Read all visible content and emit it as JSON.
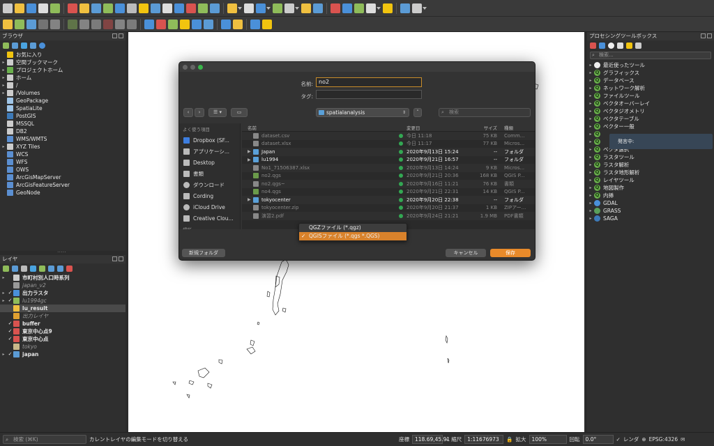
{
  "browser": {
    "title": "ブラウザ",
    "items": [
      {
        "label": "お気に入り",
        "icon": "star-icon",
        "color": "#f1c40f"
      },
      {
        "label": "空間ブックマーク",
        "icon": "bookmark-icon",
        "color": "#cccccc"
      },
      {
        "label": "プロジェクトホーム",
        "icon": "project-home-icon",
        "color": "#6ab04c"
      },
      {
        "label": "ホーム",
        "icon": "home-icon",
        "color": "#cccccc"
      },
      {
        "label": "/",
        "icon": "folder-icon",
        "color": "#cccccc"
      },
      {
        "label": "/Volumes",
        "icon": "folder-icon",
        "color": "#cccccc"
      },
      {
        "label": "GeoPackage",
        "icon": "geopackage-icon",
        "color": "#9fc5e8"
      },
      {
        "label": "SpatiaLite",
        "icon": "spatialite-icon",
        "color": "#9fc5e8"
      },
      {
        "label": "PostGIS",
        "icon": "postgis-icon",
        "color": "#3d7ab8"
      },
      {
        "label": "MSSQL",
        "icon": "mssql-icon",
        "color": "#cccccc"
      },
      {
        "label": "DB2",
        "icon": "db2-icon",
        "color": "#cccccc"
      },
      {
        "label": "WMS/WMTS",
        "icon": "wms-icon",
        "color": "#5b8fd1"
      },
      {
        "label": "XYZ Tiles",
        "icon": "xyz-tiles-icon",
        "color": "#cccccc"
      },
      {
        "label": "WCS",
        "icon": "wcs-icon",
        "color": "#5b8fd1"
      },
      {
        "label": "WFS",
        "icon": "wfs-icon",
        "color": "#5b8fd1"
      },
      {
        "label": "OWS",
        "icon": "ows-icon",
        "color": "#5b8fd1"
      },
      {
        "label": "ArcGisMapServer",
        "icon": "arcgis-icon",
        "color": "#5b8fd1"
      },
      {
        "label": "ArcGisFeatureServer",
        "icon": "arcgis-icon",
        "color": "#5b8fd1"
      },
      {
        "label": "GeoNode",
        "icon": "geonode-icon",
        "color": "#5b8fd1"
      }
    ]
  },
  "layers": {
    "title": "レイヤ",
    "items": [
      {
        "label": "市町村別人口時系列",
        "check": "",
        "style": "bold"
      },
      {
        "label": "japan_v2",
        "check": "",
        "style": "dim"
      },
      {
        "label": "出力ラスタ",
        "check": "✓",
        "style": "bold"
      },
      {
        "label": "lu1994gc",
        "check": "✓",
        "style": "dim"
      },
      {
        "label": "lu_result",
        "check": "",
        "style": "bold"
      },
      {
        "label": "出力レイヤ",
        "check": "",
        "style": "dim"
      },
      {
        "label": "buffer",
        "check": "✓",
        "style": "bold"
      },
      {
        "label": "東京中心点9",
        "check": "✓",
        "style": "bold"
      },
      {
        "label": "東京中心点",
        "check": "✓",
        "style": "bold"
      },
      {
        "label": "tokyo",
        "check": "",
        "style": "dim"
      },
      {
        "label": "japan",
        "check": "✓",
        "style": "bold"
      }
    ]
  },
  "toolbox": {
    "title": "プロセシングツールボックス",
    "search_placeholder": "検索...",
    "items": [
      "最近使ったツール",
      "グラフィックス",
      "データベース",
      "ネットワーク解析",
      "ファイルツール",
      "ベクタオーバーレイ",
      "ベクタジオメトリ",
      "ベクタテーブル",
      "ベクター一般",
      "",
      "",
      "ベクタ選択",
      "ラスタツール",
      "ラスタ解析",
      "ラスタ地形解析",
      "レイヤツール",
      "地図製作",
      "内挿",
      "GDAL",
      "GRASS",
      "SAGA"
    ],
    "tooltip": "発言中:"
  },
  "dialog": {
    "name_label": "名前:",
    "name_value": "no2",
    "tags_label": "タグ:",
    "location": "spatialanalysis",
    "search_placeholder": "検索",
    "sidebar_header": "よく使う項目",
    "sidebar": [
      {
        "label": "Dropbox (SF...",
        "icon": "dropbox-icon"
      },
      {
        "label": "アプリケーシ...",
        "icon": "applications-icon"
      },
      {
        "label": "Desktop",
        "icon": "desktop-icon"
      },
      {
        "label": "書類",
        "icon": "documents-icon"
      },
      {
        "label": "ダウンロード",
        "icon": "downloads-icon"
      },
      {
        "label": "Cording",
        "icon": "folder-icon"
      },
      {
        "label": "iCloud Drive",
        "icon": "icloud-icon"
      },
      {
        "label": "Creative Clou...",
        "icon": "creative-cloud-icon"
      }
    ],
    "sidebar_footer": "場所",
    "columns": {
      "name": "名前",
      "date": "変更日",
      "size": "サイズ",
      "kind": "種類"
    },
    "files": [
      {
        "name": "dataset.csv",
        "date": "今日 11:18",
        "size": "75 KB",
        "kind": "Comm...",
        "type": "file",
        "dim": true,
        "folder": false
      },
      {
        "name": "dataset.xlsx",
        "date": "今日 11:17",
        "size": "77 KB",
        "kind": "Micros...",
        "type": "file",
        "dim": true,
        "folder": false
      },
      {
        "name": "Japan",
        "date": "2020年9月13日 15:24",
        "size": "--",
        "kind": "フォルダ",
        "type": "folder",
        "dim": false,
        "folder": true
      },
      {
        "name": "lu1994",
        "date": "2020年9月21日 16:57",
        "size": "--",
        "kind": "フォルダ",
        "type": "folder",
        "dim": false,
        "folder": true
      },
      {
        "name": "No1_71506387.xlsx",
        "date": "2020年9月13日 14:24",
        "size": "9 KB",
        "kind": "Micros...",
        "type": "file",
        "dim": true,
        "folder": false
      },
      {
        "name": "no2.qgs",
        "date": "2020年9月21日 20:36",
        "size": "168 KB",
        "kind": "QGIS P...",
        "type": "qgs",
        "dim": true,
        "folder": false
      },
      {
        "name": "no2.qgs~",
        "date": "2020年9月16日 11:21",
        "size": "76 KB",
        "kind": "書類",
        "type": "file",
        "dim": true,
        "folder": false
      },
      {
        "name": "no4.qgs",
        "date": "2020年9月21日 22:31",
        "size": "14 KB",
        "kind": "QGIS P...",
        "type": "qgs",
        "dim": true,
        "folder": false
      },
      {
        "name": "tokyocenter",
        "date": "2020年9月20日 22:38",
        "size": "--",
        "kind": "フォルダ",
        "type": "folder",
        "dim": false,
        "folder": true
      },
      {
        "name": "tokyocenter.zip",
        "date": "2020年9月20日 21:37",
        "size": "1 KB",
        "kind": "ZIPアー...",
        "type": "file",
        "dim": true,
        "folder": false
      },
      {
        "name": "演習2.pdf",
        "date": "2020年9月24日 21:21",
        "size": "1.9 MB",
        "kind": "PDF書類",
        "type": "file",
        "dim": true,
        "folder": false
      }
    ],
    "format_options": [
      "QGZファイル (*.qgz)",
      "QGISファイル (*.qgs *.QGS)"
    ],
    "new_folder": "新規フォルダ",
    "cancel": "キャンセル",
    "save": "保存"
  },
  "statusbar": {
    "search_placeholder": "検索 (⌘K)",
    "message": "カレントレイヤの編集モードを切り替える",
    "coord_label": "座標",
    "coord_value": "118.69,45.91",
    "scale_label": "縮尺",
    "scale_value": "1:11676973",
    "magnifier_label": "拡大",
    "magnifier_value": "100%",
    "rotation_label": "回転",
    "rotation_value": "0.0°",
    "render_label": "レンダ",
    "crs": "EPSG:4326"
  },
  "colors": {
    "accent": "#e88a2a",
    "panel": "#2f2f2f",
    "canvas": "#ffffff"
  }
}
